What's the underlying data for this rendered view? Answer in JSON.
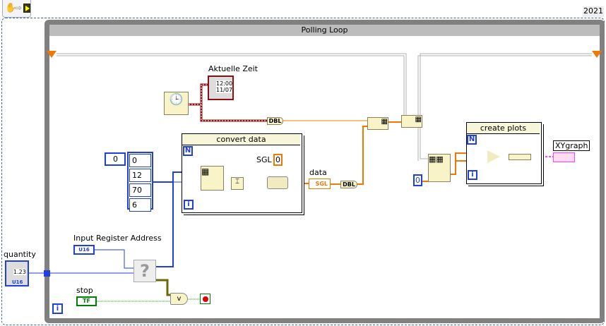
{
  "toolbar": {
    "icons": [
      "hand-icon",
      "arrow-icon",
      "run-icon"
    ]
  },
  "version": "2021",
  "while_loop": {
    "title": "Polling Loop",
    "iteration": "i"
  },
  "time": {
    "label": "Aktuelle Zeit",
    "display_time": "12:00",
    "display_date": "11/07",
    "dbl": "DBL"
  },
  "convert_loop": {
    "title": "convert data",
    "n": "N",
    "i": "i",
    "sgl_label": "SGL",
    "sgl_value": "0"
  },
  "array_const": {
    "index": "0",
    "values": [
      "0",
      "12",
      "70",
      "6"
    ]
  },
  "data": {
    "label": "data",
    "type": "SGL",
    "dbl": "DBL"
  },
  "plots_loop": {
    "title": "create plots",
    "n": "N",
    "i": "i",
    "const": "0"
  },
  "xygraph": {
    "label": "XYgraph"
  },
  "quantity": {
    "label": "quantity",
    "value": "1.23",
    "type": "U16"
  },
  "register": {
    "label": "Input Register Address",
    "type": "U16"
  },
  "unknown_node": "?",
  "stop": {
    "label": "stop",
    "type": "TF",
    "or": "v"
  },
  "colors": {
    "int": "#1f3fe0",
    "sgl": "#f07800",
    "time": "#8b1010",
    "bool": "#00a000",
    "cluster": "#ff40ff"
  }
}
